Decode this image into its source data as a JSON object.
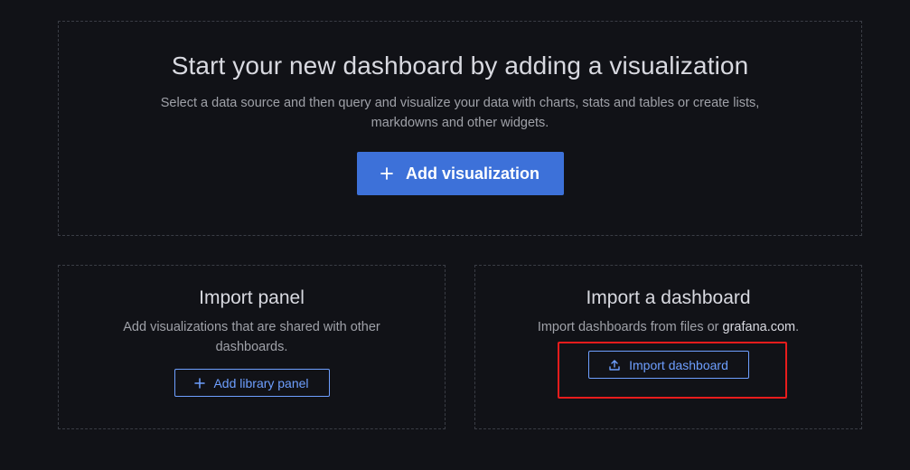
{
  "main": {
    "title": "Start your new dashboard by adding a visualization",
    "description": "Select a data source and then query and visualize your data with charts, stats and tables or create lists, markdowns and other widgets.",
    "add_visualization_label": "Add visualization",
    "add_visualization_icon": "plus-icon"
  },
  "import_panel": {
    "title": "Import panel",
    "description": "Add visualizations that are shared with other dashboards.",
    "button_label": "Add library panel",
    "button_icon": "plus-icon"
  },
  "import_dashboard": {
    "title": "Import a dashboard",
    "description_prefix": "Import dashboards from files or ",
    "description_link": "grafana.com",
    "description_suffix": ".",
    "button_label": "Import dashboard",
    "button_icon": "upload-icon"
  },
  "colors": {
    "background": "#111217",
    "primary": "#3d71d9",
    "link": "#6e9fff",
    "highlight": "#e81c1c"
  }
}
